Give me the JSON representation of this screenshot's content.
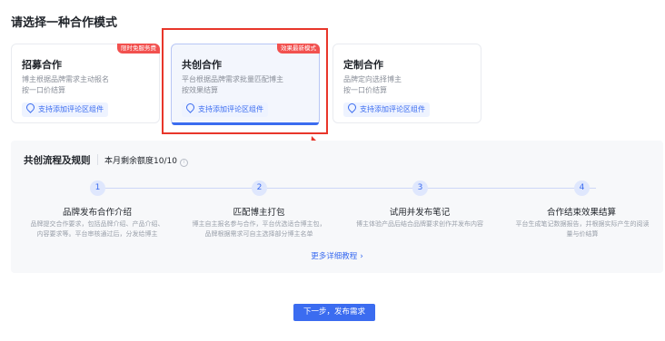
{
  "page_title": "请选择一种合作模式",
  "modes": [
    {
      "title": "招募合作",
      "desc": "博主根据品牌需求主动报名\n按一口价结算",
      "chip": "支持添加评论区组件",
      "badge": "限时免服务费"
    },
    {
      "title": "共创合作",
      "desc": "平台根据品牌需求批量匹配博主\n按效果结算",
      "chip": "支持添加评论区组件",
      "badge": "效果最新模式"
    },
    {
      "title": "定制合作",
      "desc": "品牌定向选择博主\n按一口价结算",
      "chip": "支持添加评论区组件"
    }
  ],
  "flow": {
    "title": "共创流程及规则",
    "quota": "本月剩余额度10/10",
    "steps": [
      {
        "num": "1",
        "title": "品牌发布合作介绍",
        "desc": "品牌提交合作要求，包括品牌介绍、产品介绍、\n内容要求等。平台审核通过后，分发给博主"
      },
      {
        "num": "2",
        "title": "匹配博主打包",
        "desc": "博主自主报名参与合作，平台优选适合博主包，\n品牌根据需求可自主选择部分博主名单"
      },
      {
        "num": "3",
        "title": "试用并发布笔记",
        "desc": "博主体验产品后结合品牌要求创作并发布内容"
      },
      {
        "num": "4",
        "title": "合作结束效果结算",
        "desc": "平台生成笔记数据报告，并根据实际产生的阅读\n量与价结算"
      }
    ],
    "more_label": "更多详细教程",
    "more_chevron": "›"
  },
  "next_button": "下一步，发布需求",
  "colors": {
    "accent": "#3b6cf0",
    "badge": "#f2514f",
    "highlight_box": "#e8362a"
  }
}
